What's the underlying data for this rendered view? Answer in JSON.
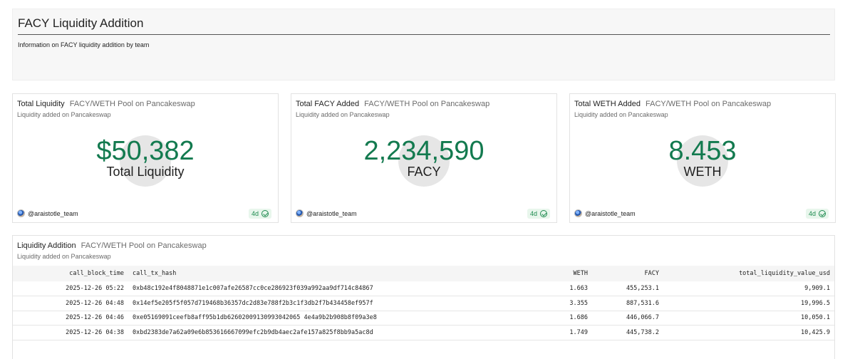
{
  "header": {
    "title": "FACY Liquidity Addition",
    "description": "Information on FACY liquidity addition by team"
  },
  "counters": [
    {
      "title": "Total Liquidity",
      "subtitle": "FACY/WETH Pool on Pancakeswap",
      "description": "Liquidity added on Pancakeswap",
      "value": "$50,382",
      "label": "Total Liquidity",
      "author": "@araistotle_team",
      "age": "4d"
    },
    {
      "title": "Total FACY Added",
      "subtitle": "FACY/WETH Pool on Pancakeswap",
      "description": "Liquidity added on Pancakeswap",
      "value": "2,234,590",
      "label": "FACY",
      "author": "@araistotle_team",
      "age": "4d"
    },
    {
      "title": "Total WETH Added",
      "subtitle": "FACY/WETH Pool on Pancakeswap",
      "description": "Liquidity added on Pancakeswap",
      "value": "8.453",
      "label": "WETH",
      "author": "@araistotle_team",
      "age": "4d"
    }
  ],
  "table": {
    "title": "Liquidity Addition",
    "subtitle": "FACY/WETH Pool on Pancakeswap",
    "description": "Liquidity added on Pancakeswap",
    "columns": [
      "call_block_time",
      "call_tx_hash",
      "WETH",
      "FACY",
      "total_liquidity_value_usd"
    ],
    "rows": [
      [
        "2025-12-26 05:22",
        "0xb48c192e4f8048871e1c007afe26587cc0ce286923f039a992aa9df714c84867",
        "1.663",
        "455,253.1",
        "9,909.1"
      ],
      [
        "2025-12-26 04:48",
        "0x14ef5e205f5f057d719468b36357dc2d83e788f2b3c1f3db2f7b434458ef957f",
        "3.355",
        "887,531.6",
        "19,996.5"
      ],
      [
        "2025-12-26 04:46",
        "0xe05169091ceefb8aff95b1db62602009130993042065 4e4a9b2b908b8f09a3e8",
        "1.686",
        "446,066.7",
        "10,050.1"
      ],
      [
        "2025-12-26 04:38",
        "0xbd2383de7a62a09e6b853616667099efc2b9db4aec2afe157a825f8bb9a5ac8d",
        "1.749",
        "445,738.2",
        "10,425.9"
      ]
    ]
  },
  "colors": {
    "accent_green": "#137a4f",
    "badge_green": "#1d8a4f",
    "badge_bg": "#e8f6ec"
  }
}
